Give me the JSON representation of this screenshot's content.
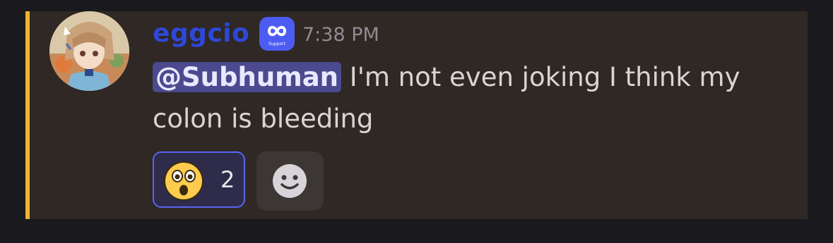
{
  "message": {
    "username": "eggcio",
    "badge": {
      "icon": "infinity-icon",
      "label": "Support",
      "color": "#4c5cf3"
    },
    "timestamp": "7:38 PM",
    "mention": "@Subhuman",
    "text": " I'm not even joking I think my colon is bleeding",
    "highlight_color": "#f0b232",
    "username_color": "#2f47d8"
  },
  "reactions": [
    {
      "emoji": "astonished-face-icon",
      "count": "2",
      "active": true
    }
  ],
  "add_reaction": {
    "icon": "smiley-icon"
  }
}
